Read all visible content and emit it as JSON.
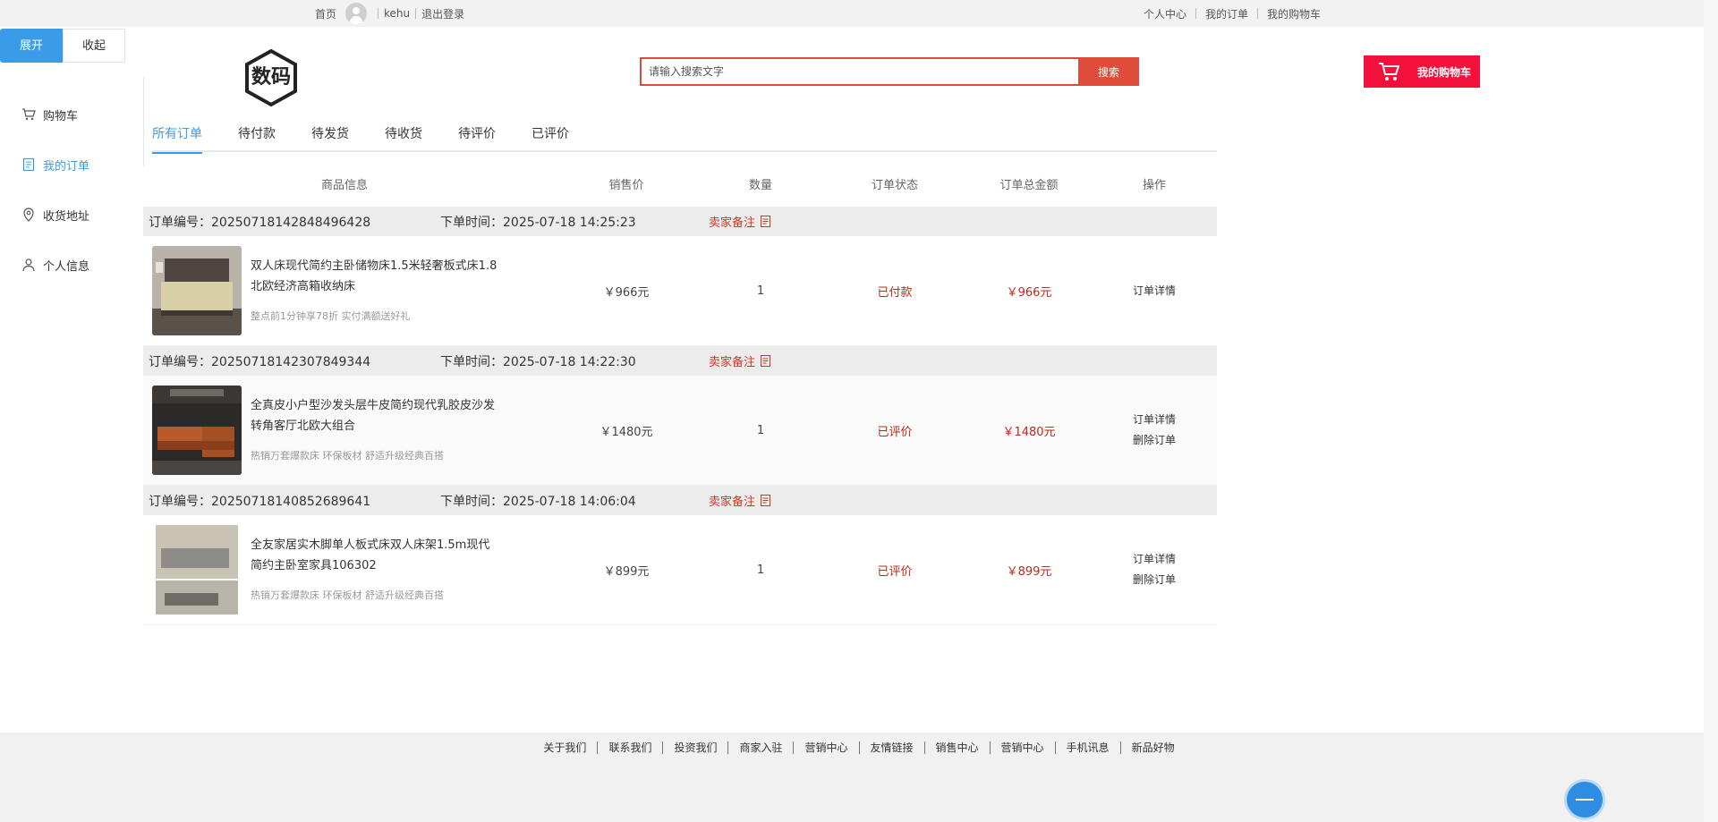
{
  "topbar": {
    "home": "首页",
    "username": "kehu",
    "logout": "退出登录",
    "personal_center": "个人中心",
    "my_orders": "我的订单",
    "my_cart": "我的购物车"
  },
  "toggles": {
    "expand": "展开",
    "collapse": "收起"
  },
  "sidebar": {
    "items": [
      {
        "label": "购物车",
        "icon": "cart-icon"
      },
      {
        "label": "我的订单",
        "icon": "document-icon",
        "active": true
      },
      {
        "label": "收货地址",
        "icon": "location-pin-icon"
      },
      {
        "label": "个人信息",
        "icon": "user-icon"
      }
    ]
  },
  "header": {
    "logo_text": "数码",
    "search_placeholder": "请输入搜索文字",
    "search_button": "搜索",
    "cart_button": "我的购物车"
  },
  "tabs": [
    "所有订单",
    "待付款",
    "待发货",
    "待收货",
    "待评价",
    "已评价"
  ],
  "table": {
    "headers": [
      "商品信息",
      "销售价",
      "数量",
      "订单状态",
      "订单总金额",
      "操作"
    ],
    "order_no_label": "订单编号：",
    "order_time_label": "下单时间：",
    "seller_note_label": "卖家备注"
  },
  "orders": [
    {
      "order_no": "20250718142848496428",
      "time": "2025-07-18 14:25:23",
      "name": "双人床现代简约主卧储物床1.5米轻奢板式床1.8北欧经济高箱收纳床",
      "promo": "整点前1分钟享78折 实付满额送好礼",
      "price": "￥966元",
      "qty": "1",
      "status": "已付款",
      "total": "￥966元",
      "ops": [
        "订单详情"
      ],
      "thumb_colors": [
        "#6b5e52",
        "#d8cfa6"
      ]
    },
    {
      "order_no": "20250718142307849344",
      "time": "2025-07-18 14:22:30",
      "name": "全真皮小户型沙发头层牛皮简约现代乳胶皮沙发转角客厅北欧大组合",
      "promo": "热销万套爆款床 环保板材 舒适升级经典百搭",
      "price": "￥1480元",
      "qty": "1",
      "status": "已评价",
      "total": "￥1480元",
      "ops": [
        "订单详情",
        "删除订单"
      ],
      "thumb_colors": [
        "#2c2a28",
        "#b85a2a"
      ]
    },
    {
      "order_no": "20250718140852689641",
      "time": "2025-07-18 14:06:04",
      "name": "全友家居实木脚单人板式床双人床架1.5m现代简约主卧室家具106302",
      "promo": "热销万套爆款床 环保板材 舒适升级经典百搭",
      "price": "￥899元",
      "qty": "1",
      "status": "已评价",
      "total": "￥899元",
      "ops": [
        "订单详情",
        "删除订单"
      ],
      "thumb_colors": [
        "#8d8c88",
        "#c9c3b4"
      ]
    }
  ],
  "footer": {
    "links": [
      "关于我们",
      "联系我们",
      "投资我们",
      "商家入驻",
      "营销中心",
      "友情链接",
      "销售中心",
      "营销中心",
      "手机讯息",
      "新品好物"
    ]
  },
  "colors": {
    "accent": "#3a9ce8",
    "search_red": "#e04c3a",
    "cart_red": "#f3103a",
    "status_red": "#c1271b"
  }
}
